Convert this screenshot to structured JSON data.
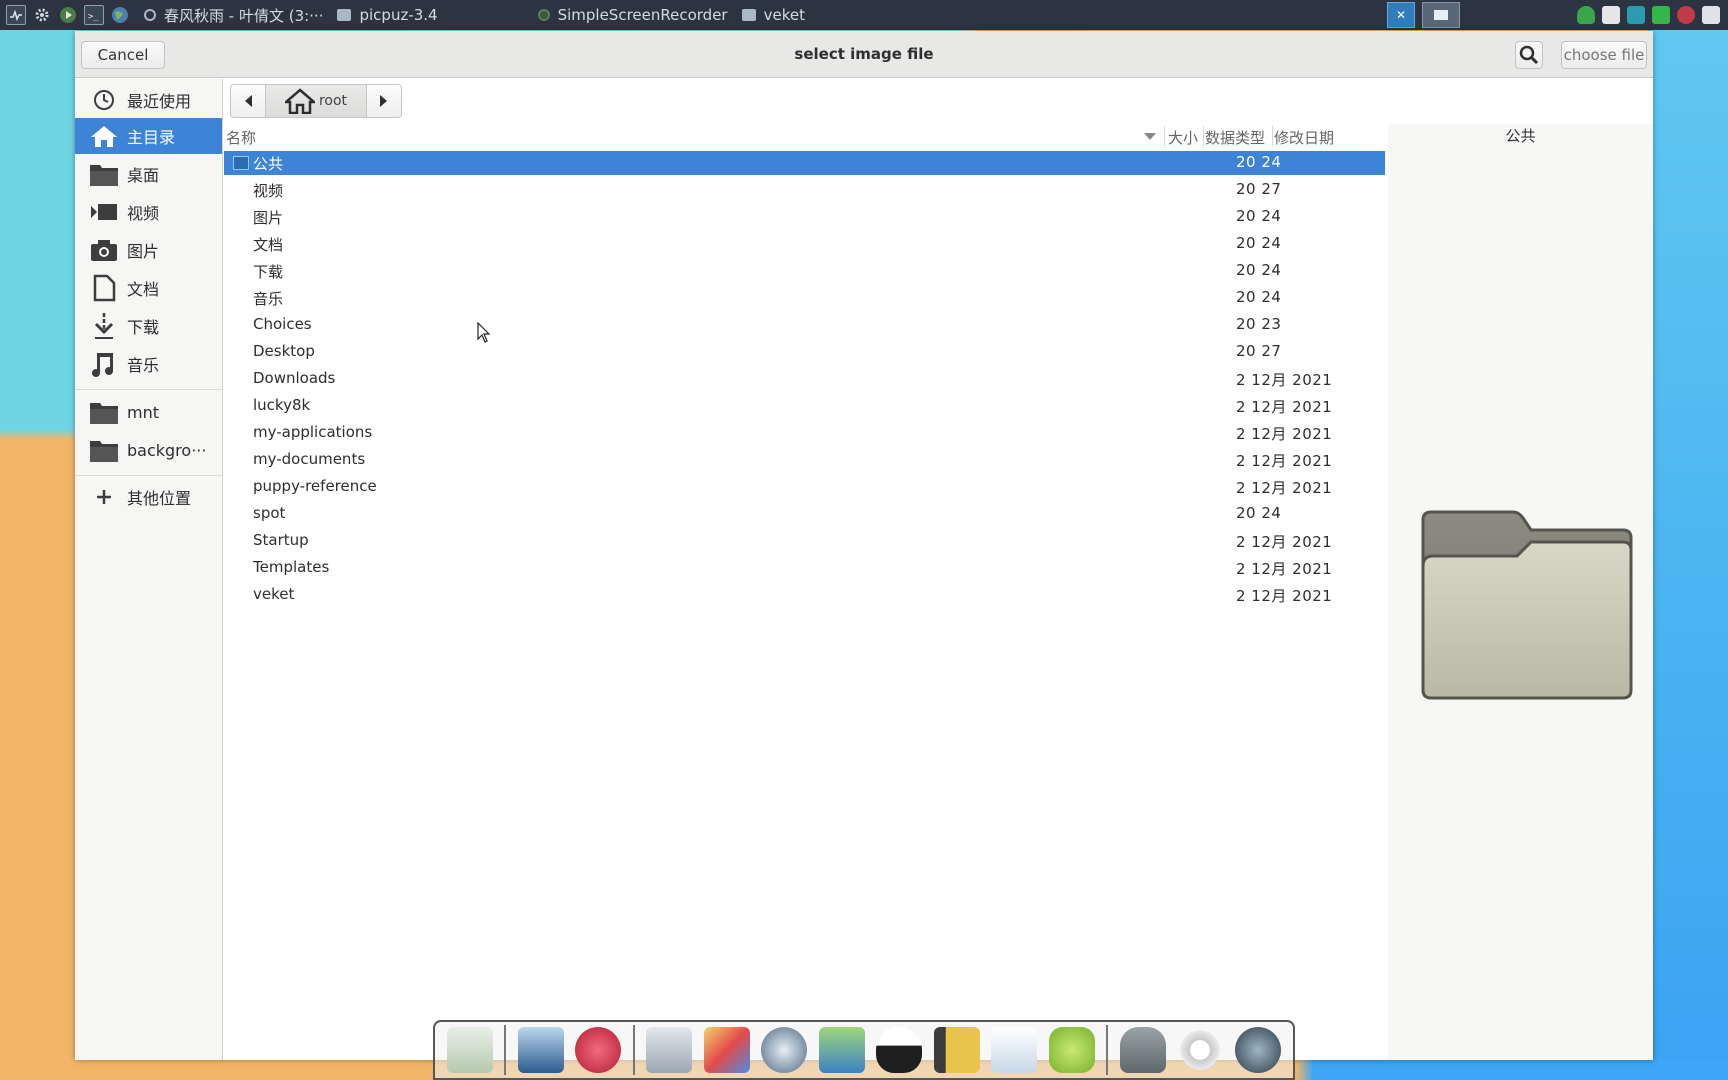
{
  "taskbar": {
    "tasks": [
      {
        "label": "春风秋雨 - 叶倩文 (3:···"
      },
      {
        "label": "picpuz-3.4"
      },
      {
        "label": "SimpleScreenRecorder"
      },
      {
        "label": "veket"
      }
    ]
  },
  "dialog": {
    "title": "select image file",
    "cancel_label": "Cancel",
    "choose_label": "choose file"
  },
  "sidebar": {
    "items": [
      {
        "label": "最近使用",
        "icon": "clock-icon"
      },
      {
        "label": "主目录",
        "icon": "home-icon"
      },
      {
        "label": "桌面",
        "icon": "folder-icon"
      },
      {
        "label": "视频",
        "icon": "video-icon"
      },
      {
        "label": "图片",
        "icon": "camera-icon"
      },
      {
        "label": "文档",
        "icon": "document-icon"
      },
      {
        "label": "下载",
        "icon": "download-icon"
      },
      {
        "label": "音乐",
        "icon": "music-icon"
      },
      {
        "label": "mnt",
        "icon": "folder-icon"
      },
      {
        "label": "backgro···",
        "icon": "folder-icon"
      },
      {
        "label": "其他位置",
        "icon": "plus-icon"
      }
    ]
  },
  "pathbar": {
    "current": "root"
  },
  "columns": {
    "name": "名称",
    "size": "大小",
    "type": "数据类型",
    "modified": "修改日期"
  },
  "files": [
    {
      "name": "公共",
      "modified": "20 24",
      "selected": true
    },
    {
      "name": "视频",
      "modified": "20 27"
    },
    {
      "name": "图片",
      "modified": "20 24"
    },
    {
      "name": "文档",
      "modified": "20 24"
    },
    {
      "name": "下载",
      "modified": "20 24"
    },
    {
      "name": "音乐",
      "modified": "20 24"
    },
    {
      "name": "Choices",
      "modified": "20 23"
    },
    {
      "name": "Desktop",
      "modified": "20 27"
    },
    {
      "name": "Downloads",
      "modified": "2 12月 2021"
    },
    {
      "name": "lucky8k",
      "modified": "2 12月 2021"
    },
    {
      "name": "my-applications",
      "modified": "2 12月 2021"
    },
    {
      "name": "my-documents",
      "modified": "2 12月 2021"
    },
    {
      "name": "puppy-reference",
      "modified": "2 12月 2021"
    },
    {
      "name": "spot",
      "modified": "20 24"
    },
    {
      "name": "Startup",
      "modified": "2 12月 2021"
    },
    {
      "name": "Templates",
      "modified": "2 12月 2021"
    },
    {
      "name": "veket",
      "modified": "2 12月 2021"
    }
  ],
  "preview": {
    "name": "公共"
  },
  "colors": {
    "accent": "#3d84d8",
    "taskbar": "#2b3440"
  }
}
